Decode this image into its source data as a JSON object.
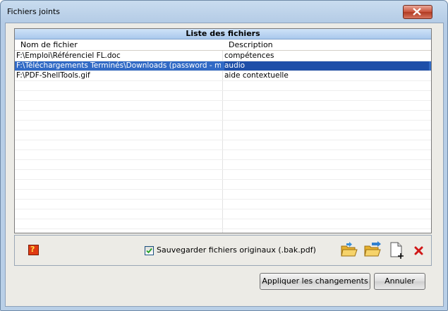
{
  "window": {
    "title": "Fichiers joints"
  },
  "list": {
    "title": "Liste des fichiers",
    "columns": [
      "Nom de fichier",
      "Description"
    ],
    "rows": [
      {
        "file": "F:\\Emploi\\Référenciel FL.doc",
        "description": "compétences"
      },
      {
        "file": "F:\\Téléchargements Terminés\\Downloads (password - m...",
        "description": "audio"
      },
      {
        "file": "F:\\PDF-ShellTools.gif",
        "description": "aide contextuelle"
      }
    ],
    "selected_row": 1
  },
  "options": {
    "save_originals_label": "Sauvegarder fichiers originaux (.bak.pdf)",
    "save_originals_checked": true
  },
  "toolbar": {
    "icons": [
      "open-folder-icon",
      "folder-arrow-icon",
      "new-file-icon",
      "delete-icon",
      "help-icon"
    ]
  },
  "buttons": {
    "apply": "Appliquer les changements",
    "cancel": "Annuler"
  },
  "colors": {
    "selection": "#316ac5",
    "header_gradient_top": "#cfe3f8",
    "close_red": "#c9523a"
  }
}
